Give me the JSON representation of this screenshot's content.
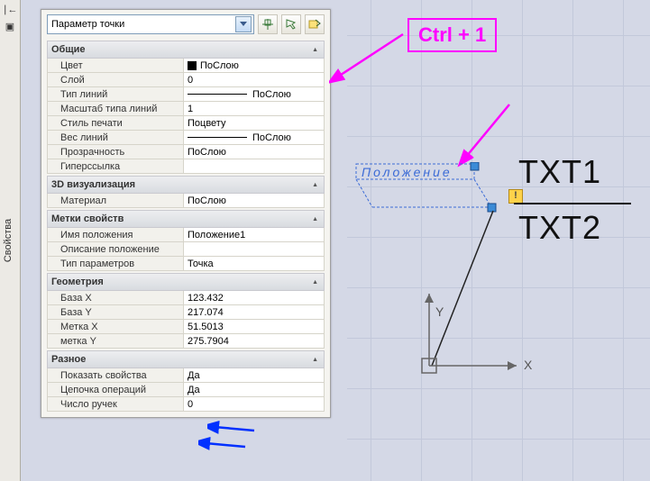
{
  "panel_title": "Свойства",
  "selector": {
    "value": "Параметр точки"
  },
  "toolbar_icons": [
    "new",
    "pick",
    "apply"
  ],
  "sections": {
    "common": {
      "title": "Общие",
      "rows": {
        "color": {
          "k": "Цвет",
          "v": "ПоСлою"
        },
        "layer": {
          "k": "Слой",
          "v": "0"
        },
        "ltype": {
          "k": "Тип линий",
          "v": "ПоСлою"
        },
        "lscale": {
          "k": "Масштаб типа линий",
          "v": "1"
        },
        "pstyle": {
          "k": "Стиль печати",
          "v": "Поцвету"
        },
        "lweight": {
          "k": "Вес линий",
          "v": "ПоСлою"
        },
        "transp": {
          "k": "Прозрачность",
          "v": "ПоСлою"
        },
        "hyper": {
          "k": "Гиперссылка",
          "v": ""
        }
      }
    },
    "viz3d": {
      "title": "3D визуализация",
      "rows": {
        "material": {
          "k": "Материал",
          "v": "ПоСлою"
        }
      }
    },
    "tags": {
      "title": "Метки свойств",
      "rows": {
        "posname": {
          "k": "Имя положения",
          "v": "Положение1"
        },
        "posdesc": {
          "k": "Описание положение",
          "v": ""
        },
        "ptype": {
          "k": "Тип параметров",
          "v": "Точка"
        }
      }
    },
    "geom": {
      "title": "Геометрия",
      "rows": {
        "bx": {
          "k": "База X",
          "v": "123.432"
        },
        "by": {
          "k": "База Y",
          "v": "217.074"
        },
        "mx": {
          "k": "Метка X",
          "v": "51.5013"
        },
        "my": {
          "k": "метка Y",
          "v": "275.7904"
        }
      }
    },
    "misc": {
      "title": "Разное",
      "rows": {
        "showprops": {
          "k": "Показать свойства",
          "v": "Да"
        },
        "chain": {
          "k": "Цепочка операций",
          "v": "Да"
        },
        "grips": {
          "k": "Число ручек",
          "v": "0"
        }
      }
    }
  },
  "annotation": {
    "ctrl_label": "Ctrl + 1"
  },
  "canvas": {
    "pos_label": "Положение",
    "txt1": "TXT1",
    "txt2": "TXT2",
    "axis_x": "X",
    "axis_y": "Y",
    "warn_icon": "!"
  }
}
